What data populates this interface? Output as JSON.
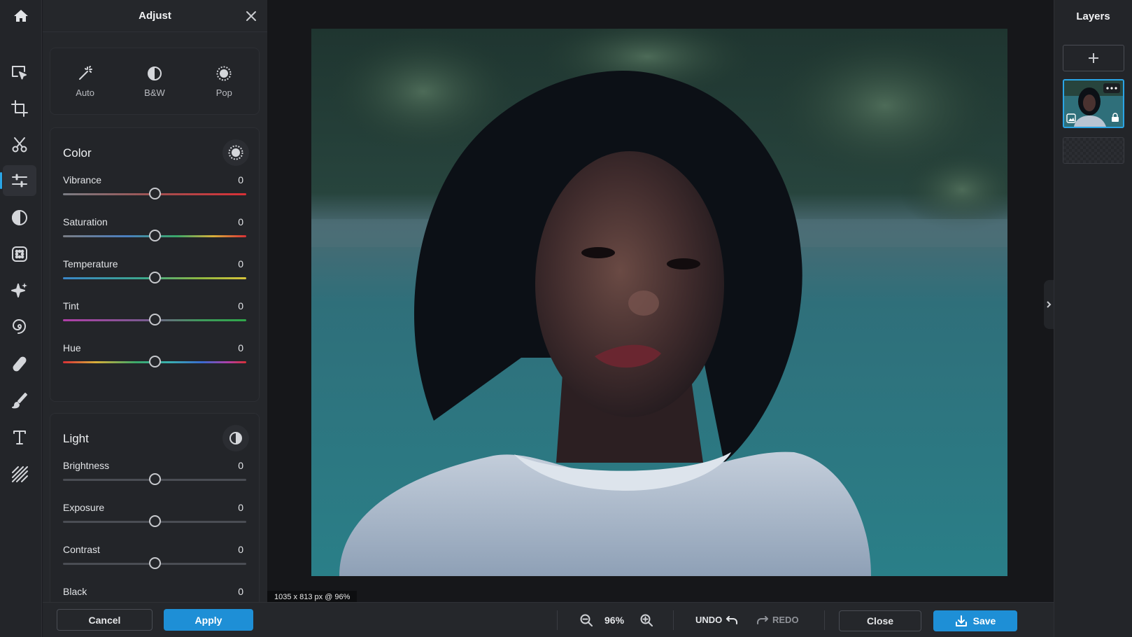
{
  "adjust_panel": {
    "title": "Adjust",
    "presets": [
      {
        "label": "Auto",
        "icon": "magic-wand-icon"
      },
      {
        "label": "B&W",
        "icon": "half-circle-icon"
      },
      {
        "label": "Pop",
        "icon": "sun-icon"
      }
    ],
    "color": {
      "title": "Color",
      "sliders": [
        {
          "label": "Vibrance",
          "value": "0"
        },
        {
          "label": "Saturation",
          "value": "0"
        },
        {
          "label": "Temperature",
          "value": "0"
        },
        {
          "label": "Tint",
          "value": "0"
        },
        {
          "label": "Hue",
          "value": "0"
        }
      ]
    },
    "light": {
      "title": "Light",
      "sliders": [
        {
          "label": "Brightness",
          "value": "0"
        },
        {
          "label": "Exposure",
          "value": "0"
        },
        {
          "label": "Contrast",
          "value": "0"
        },
        {
          "label": "Black",
          "value": "0"
        }
      ]
    },
    "cancel_label": "Cancel",
    "apply_label": "Apply"
  },
  "canvas": {
    "info": "1035 x 813 px @ 96%"
  },
  "layers_panel": {
    "title": "Layers"
  },
  "bottombar": {
    "zoom": "96%",
    "undo_label": "UNDO",
    "redo_label": "REDO",
    "close_label": "Close",
    "save_label": "Save"
  },
  "colors": {
    "accent": "#1e8fd6",
    "panel_bg": "#25272b",
    "canvas_bg": "#16171a"
  }
}
